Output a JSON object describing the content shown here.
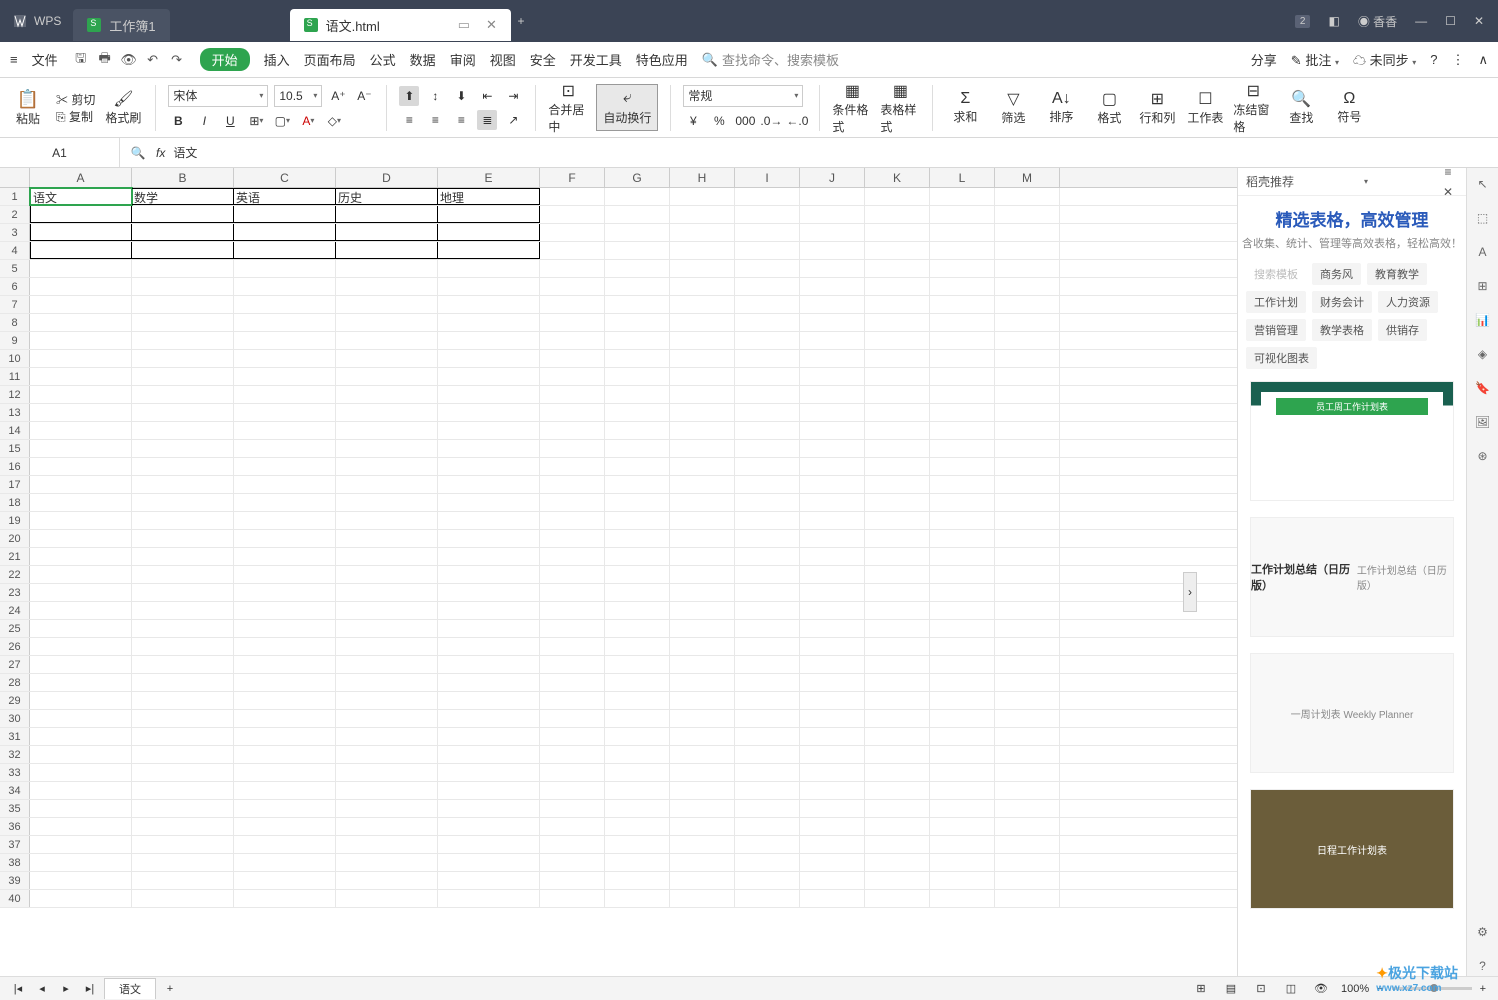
{
  "titlebar": {
    "app": "WPS",
    "tabs": [
      {
        "label": "工作簿1",
        "active": false
      },
      {
        "label": "语文.html",
        "active": true
      }
    ],
    "user": "香香",
    "notif": "2"
  },
  "menubar": {
    "file": "文件",
    "items": [
      "开始",
      "插入",
      "页面布局",
      "公式",
      "数据",
      "审阅",
      "视图",
      "安全",
      "开发工具",
      "特色应用"
    ],
    "search_placeholder": "查找命令、搜索模板",
    "right": [
      "分享",
      "批注",
      "未同步"
    ],
    "batch_icon": "✎"
  },
  "ribbon": {
    "paste": "粘贴",
    "cut": "剪切",
    "copy": "复制",
    "format_painter": "格式刷",
    "font": "宋体",
    "font_size": "10.5",
    "merge": "合并居中",
    "autowrap": "自动换行",
    "number_format": "常规",
    "cond_format": "条件格式",
    "table_style": "表格样式",
    "sum": "求和",
    "filter": "筛选",
    "sort": "排序",
    "format": "格式",
    "rowcol": "行和列",
    "sheet": "工作表",
    "freeze": "冻结窗格",
    "find": "查找",
    "symbol": "符号"
  },
  "formula": {
    "cell_ref": "A1",
    "value": "语文"
  },
  "grid": {
    "columns": [
      "A",
      "B",
      "C",
      "D",
      "E",
      "F",
      "G",
      "H",
      "I",
      "J",
      "K",
      "L",
      "M"
    ],
    "row_count": 40,
    "data": {
      "1": {
        "A": "语文",
        "B": "数学",
        "C": "英语",
        "D": "历史",
        "E": "地理"
      }
    },
    "bordered_range": {
      "r1": 1,
      "r2": 4,
      "c1": 0,
      "c2": 4
    },
    "active": "A1"
  },
  "side": {
    "header": "稻壳推荐",
    "title": "精选表格，高效管理",
    "subtitle": "含收集、统计、管理等高效表格，轻松高效！",
    "search_ph": "搜索模板",
    "tags": [
      "商务风",
      "教育教学",
      "工作计划",
      "财务会计",
      "人力资源",
      "营销管理",
      "教学表格",
      "供销存",
      "可视化图表"
    ],
    "templates": [
      "员工周工作计划表",
      "工作计划总结（日历版）",
      "一周计划表 Weekly Planner",
      "日程工作计划表"
    ]
  },
  "sheets": {
    "active": "语文",
    "add": "+"
  },
  "status": {
    "zoom": "100%"
  },
  "watermark": "极光下载站",
  "watermark_url": "www.xz7.com"
}
